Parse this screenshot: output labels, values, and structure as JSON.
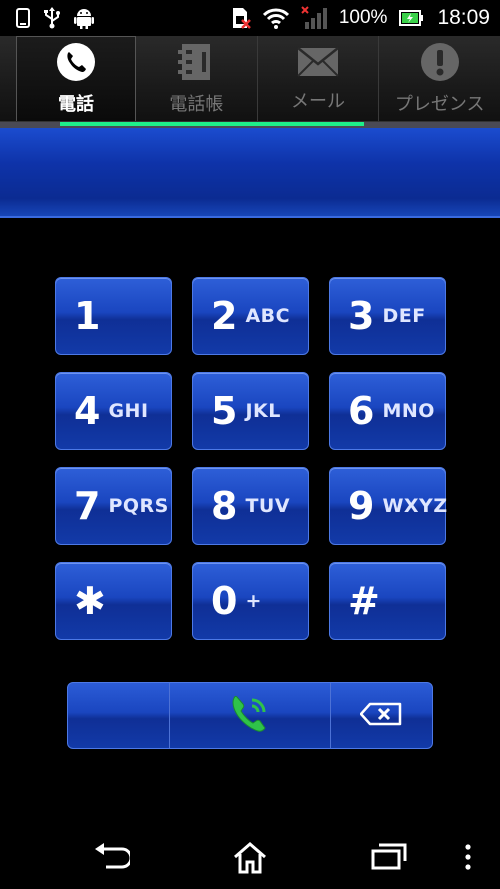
{
  "status_bar": {
    "battery_text": "100%",
    "time": "18:09",
    "icons": [
      "phone-icon",
      "usb-icon",
      "android-icon",
      "sim-icon",
      "wifi-icon",
      "signal-icon",
      "battery-icon"
    ]
  },
  "tabs": [
    {
      "label": "電話",
      "icon": "phone-icon",
      "active": true
    },
    {
      "label": "電話帳",
      "icon": "phonebook-icon",
      "active": false
    },
    {
      "label": "メール",
      "icon": "envelope-icon",
      "active": false
    },
    {
      "label": "プレゼンス",
      "icon": "presence-icon",
      "active": false
    }
  ],
  "number_display": {
    "value": ""
  },
  "keypad": [
    {
      "digit": "1",
      "letters": ""
    },
    {
      "digit": "2",
      "letters": "ABC"
    },
    {
      "digit": "3",
      "letters": "DEF"
    },
    {
      "digit": "4",
      "letters": "GHI"
    },
    {
      "digit": "5",
      "letters": "JKL"
    },
    {
      "digit": "6",
      "letters": "MNO"
    },
    {
      "digit": "7",
      "letters": "PQRS"
    },
    {
      "digit": "8",
      "letters": "TUV"
    },
    {
      "digit": "9",
      "letters": "WXYZ"
    },
    {
      "digit": "✱",
      "letters": ""
    },
    {
      "digit": "0",
      "letters": "+"
    },
    {
      "digit": "#",
      "letters": ""
    }
  ],
  "colors": {
    "key_blue": "#1a46c0",
    "accent_green": "#1ef08a",
    "call_green": "#2fc24a"
  }
}
